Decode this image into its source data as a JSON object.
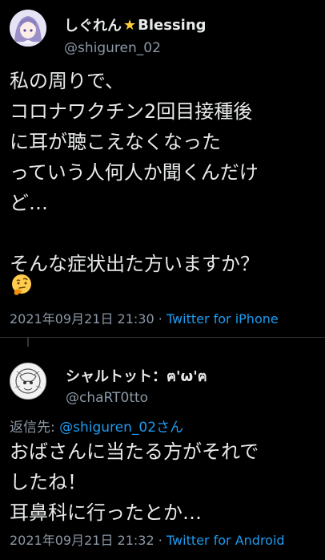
{
  "tweets": [
    {
      "display_name": "しぐれん",
      "name_suffix": "Blessing",
      "name_emoji": "★",
      "handle": "@shiguren_02",
      "text": "私の周りで、\nコロナワクチン2回目接種後\nに耳が聴こえなくなった\nっていう人何人か聞くんだけ\nど…\n\nそんな症状出た方いますか？",
      "emoji": "thinking-face-icon",
      "timestamp": "2021年09月21日 21:30",
      "separator": " · ",
      "source": "Twitter for iPhone"
    },
    {
      "display_name": "シャルトット：ฅ'ω'ฅ",
      "handle": "@chaRT0tto",
      "reply_prefix": "返信先: ",
      "reply_mention": "@shiguren_02さん",
      "text": "おばさんに当たる方がそれで\nしたね！\n耳鼻科に行ったとか…",
      "timestamp": "2021年09月21日 21:32",
      "separator": " · ",
      "source": "Twitter for Android"
    }
  ],
  "colors": {
    "background": "#000000",
    "text": "#e7e9ea",
    "secondary": "#8b98a5",
    "link": "#1d9bf0",
    "star": "#ffcc33"
  }
}
